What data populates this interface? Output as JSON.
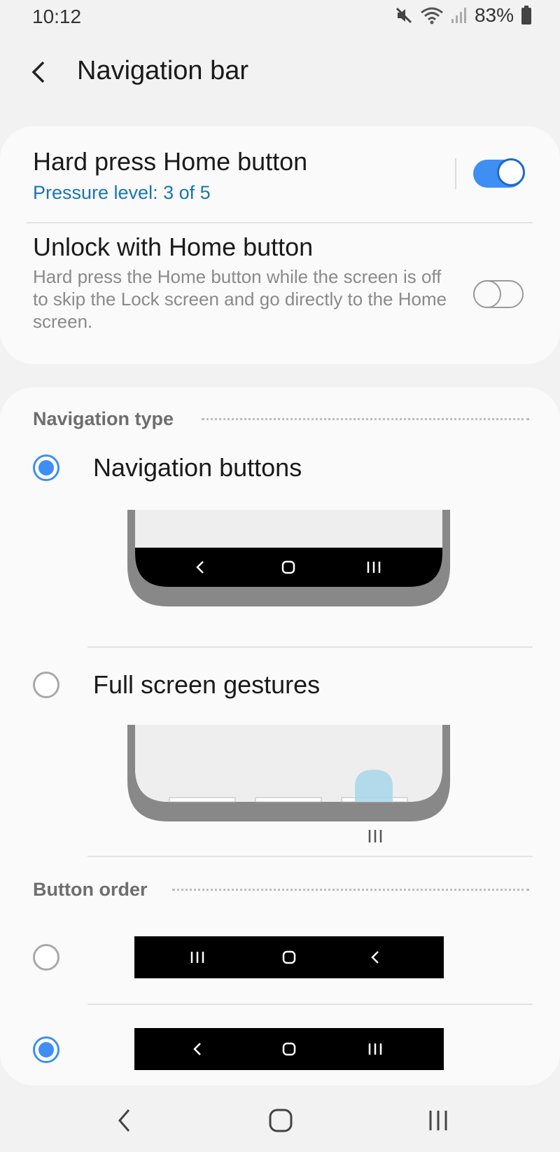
{
  "status_bar": {
    "time": "10:12",
    "battery_percent": "83%",
    "icons": [
      "mute-icon",
      "wifi-icon",
      "signal-icon",
      "battery-icon"
    ]
  },
  "header": {
    "title": "Navigation bar",
    "back_icon": "back-arrow-icon"
  },
  "settings": {
    "hard_press": {
      "title": "Hard press Home button",
      "subtitle": "Pressure level: 3 of 5",
      "enabled": true
    },
    "unlock_home": {
      "title": "Unlock with Home button",
      "description": "Hard press the Home button while the screen is off to skip the Lock screen and go directly to the Home screen.",
      "enabled": false
    }
  },
  "navigation_type": {
    "header": "Navigation type",
    "options": [
      {
        "label": "Navigation buttons",
        "selected": true
      },
      {
        "label": "Full screen gestures",
        "selected": false
      }
    ]
  },
  "button_order": {
    "header": "Button order",
    "options": [
      {
        "order": [
          "recents-icon",
          "home-icon",
          "back-icon"
        ],
        "selected": false
      },
      {
        "order": [
          "back-icon",
          "home-icon",
          "recents-icon"
        ],
        "selected": true
      }
    ]
  },
  "colors": {
    "accent": "#3e8ef4",
    "link": "#1a75b4",
    "background": "#f2f2f2",
    "card": "#fafafa"
  }
}
